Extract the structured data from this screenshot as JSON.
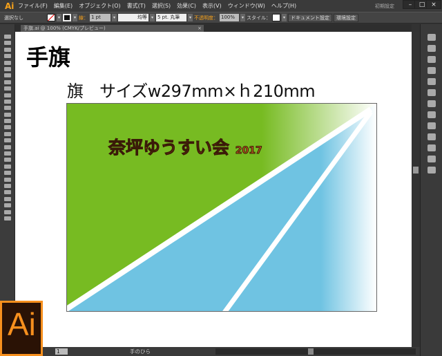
{
  "app": {
    "logo": "Ai",
    "menu": [
      "ファイル(F)",
      "編集(E)",
      "オブジェクト(O)",
      "書式(T)",
      "選択(S)",
      "効果(C)",
      "表示(V)",
      "ウィンドウ(W)",
      "ヘルプ(H)"
    ],
    "workspace": "初期設定",
    "window_buttons": [
      "–",
      "□",
      "×"
    ]
  },
  "control": {
    "selection": "選択なし",
    "stroke_label": "線：",
    "stroke_weight": "1 pt",
    "stroke_style": "均等",
    "brush": "5 pt. 丸筆",
    "opacity_label": "不透明度：",
    "opacity": "100%",
    "style_label": "スタイル：",
    "doc_setup": "ドキュメント設定",
    "prefs": "環境設定"
  },
  "tab": {
    "title": "手旗.ai @ 100% (CMYK/プレビュー)",
    "close": "×"
  },
  "artboard": {
    "heading": "手旗",
    "size_text": "旗　サイズw297mm×ｈ210mm",
    "flag_text": "奈坪ゆうすい会",
    "flag_year": "2017"
  },
  "colors": {
    "green": "#77bb22",
    "blue": "#6fc3e2",
    "lettering": "#b85a1c",
    "accent": "#f7a21b"
  },
  "status": {
    "page": "1",
    "tool": "手のひら"
  }
}
